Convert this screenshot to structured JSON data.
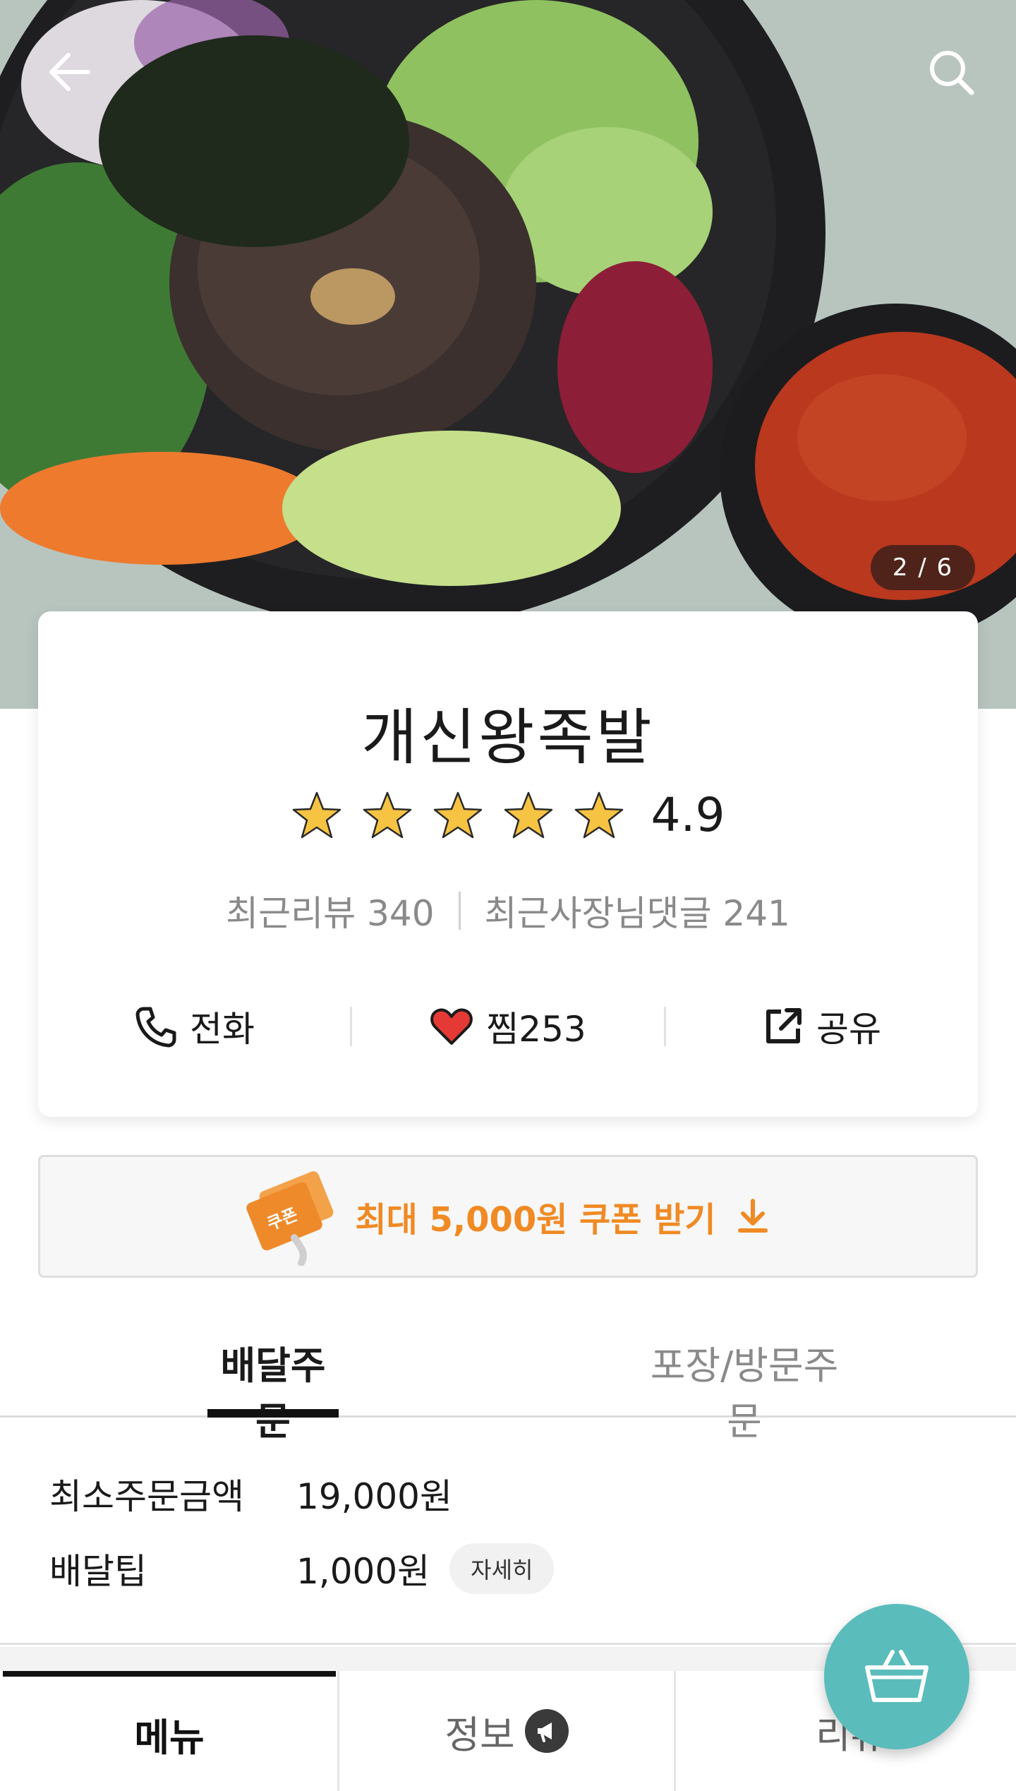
{
  "hero": {
    "pager": "2 / 6"
  },
  "store": {
    "name": "개신왕족발",
    "rating": "4.9",
    "star_count": 5,
    "recent_reviews": "최근리뷰 340",
    "recent_owner_replies": "최근사장님댓글 241"
  },
  "actions": {
    "call_label": "전화",
    "like_label": "찜253",
    "share_label": "공유"
  },
  "coupon": {
    "label": "최대 5,000원 쿠폰 받기",
    "ticket_text": "쿠폰"
  },
  "order_tabs": {
    "delivery": "배달주문",
    "pickup": "포장/방문주문"
  },
  "fees": {
    "min_order_label": "최소주문금액",
    "min_order_value": "19,000원",
    "delivery_tip_label": "배달팁",
    "delivery_tip_value": "1,000원",
    "detail_button": "자세히"
  },
  "bottom_tabs": {
    "menu": "메뉴",
    "info": "정보",
    "review": "리뷰"
  },
  "colors": {
    "accent_orange": "#f08a24",
    "cart_teal": "#5bbcbc",
    "star_yellow": "#f6c343",
    "heart_red": "#e53935"
  },
  "icons": [
    "back-arrow-icon",
    "search-icon",
    "star-icon",
    "phone-icon",
    "heart-icon",
    "share-icon",
    "coupon-ticket-icon",
    "download-arrow-icon",
    "megaphone-icon",
    "cart-basket-icon"
  ]
}
